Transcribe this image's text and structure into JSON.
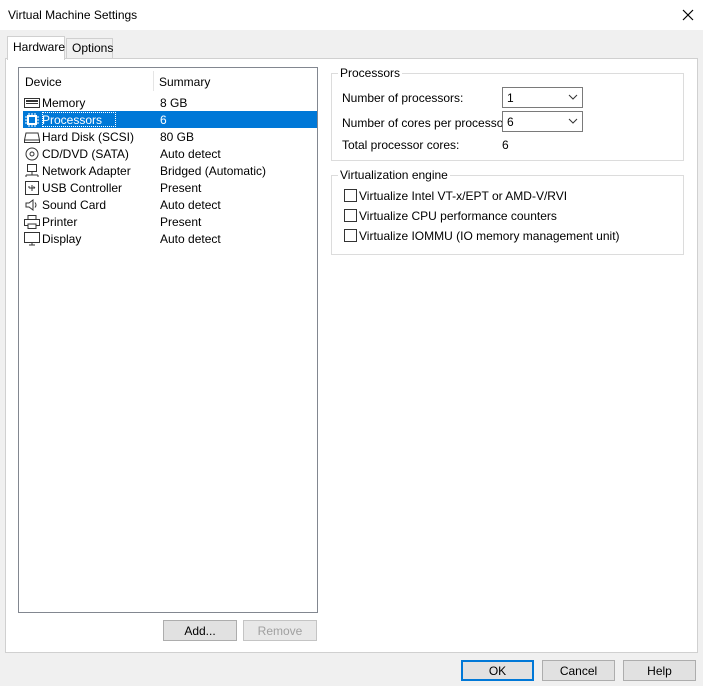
{
  "window": {
    "title": "Virtual Machine Settings"
  },
  "tabs": [
    {
      "label": "Hardware",
      "active": true
    },
    {
      "label": "Options",
      "active": false
    }
  ],
  "device_list": {
    "columns": [
      "Device",
      "Summary"
    ],
    "rows": [
      {
        "device": "Memory",
        "summary": "8 GB",
        "icon": "memory-icon"
      },
      {
        "device": "Processors",
        "summary": "6",
        "icon": "processor-icon",
        "selected": true
      },
      {
        "device": "Hard Disk (SCSI)",
        "summary": "80 GB",
        "icon": "hard-disk-icon"
      },
      {
        "device": "CD/DVD (SATA)",
        "summary": "Auto detect",
        "icon": "cd-dvd-icon"
      },
      {
        "device": "Network Adapter",
        "summary": "Bridged (Automatic)",
        "icon": "network-adapter-icon"
      },
      {
        "device": "USB Controller",
        "summary": "Present",
        "icon": "usb-icon"
      },
      {
        "device": "Sound Card",
        "summary": "Auto detect",
        "icon": "speaker-icon"
      },
      {
        "device": "Printer",
        "summary": "Present",
        "icon": "printer-icon"
      },
      {
        "device": "Display",
        "summary": "Auto detect",
        "icon": "monitor-icon"
      }
    ]
  },
  "list_buttons": {
    "add": "Add...",
    "remove": "Remove"
  },
  "processors": {
    "title": "Processors",
    "num_processors_label": "Number of processors:",
    "num_processors_value": "1",
    "cores_label": "Number of cores per processor:",
    "cores_value": "6",
    "total_label": "Total processor cores:",
    "total_value": "6"
  },
  "virtualization": {
    "title": "Virtualization engine",
    "options": [
      {
        "label": "Virtualize Intel VT-x/EPT or AMD-V/RVI",
        "checked": false
      },
      {
        "label": "Virtualize CPU performance counters",
        "checked": false
      },
      {
        "label": "Virtualize IOMMU (IO memory management unit)",
        "checked": false
      }
    ]
  },
  "footer": {
    "ok": "OK",
    "cancel": "Cancel",
    "help": "Help"
  },
  "colors": {
    "selection": "#0078d7",
    "accent": "#0078d7"
  }
}
